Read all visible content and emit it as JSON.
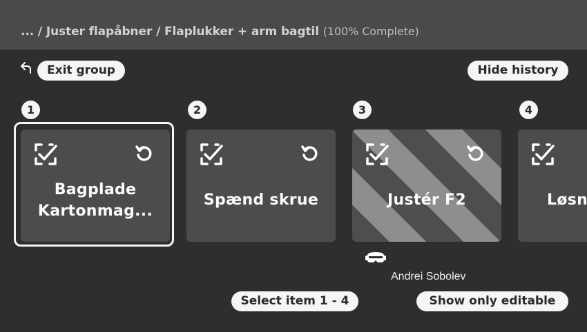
{
  "header": {
    "breadcrumb": "... / Juster flapåbner / Flaplukker + arm bagtil",
    "completion": "(100% Complete)"
  },
  "toolbar": {
    "exit_group_label": "Exit group",
    "hide_history_label": "Hide history"
  },
  "items": [
    {
      "number": "1",
      "label": "Bagplade Kartonmag...",
      "selected": true,
      "striped": false
    },
    {
      "number": "2",
      "label": "Spænd skrue",
      "selected": false,
      "striped": false
    },
    {
      "number": "3",
      "label": "Justér F2",
      "selected": false,
      "striped": true
    },
    {
      "number": "4",
      "label": "Løsn",
      "selected": false,
      "striped": false
    }
  ],
  "active_user": {
    "icon": "headset-icon",
    "name": "Andrei Sobolev"
  },
  "footer": {
    "select_label": "Select item 1 - 4",
    "show_editable_label": "Show only editable"
  },
  "colors": {
    "background": "#2e2e2e",
    "header": "#4a4a4a",
    "card": "#4c4c4c",
    "pill": "#f5f5f5"
  }
}
